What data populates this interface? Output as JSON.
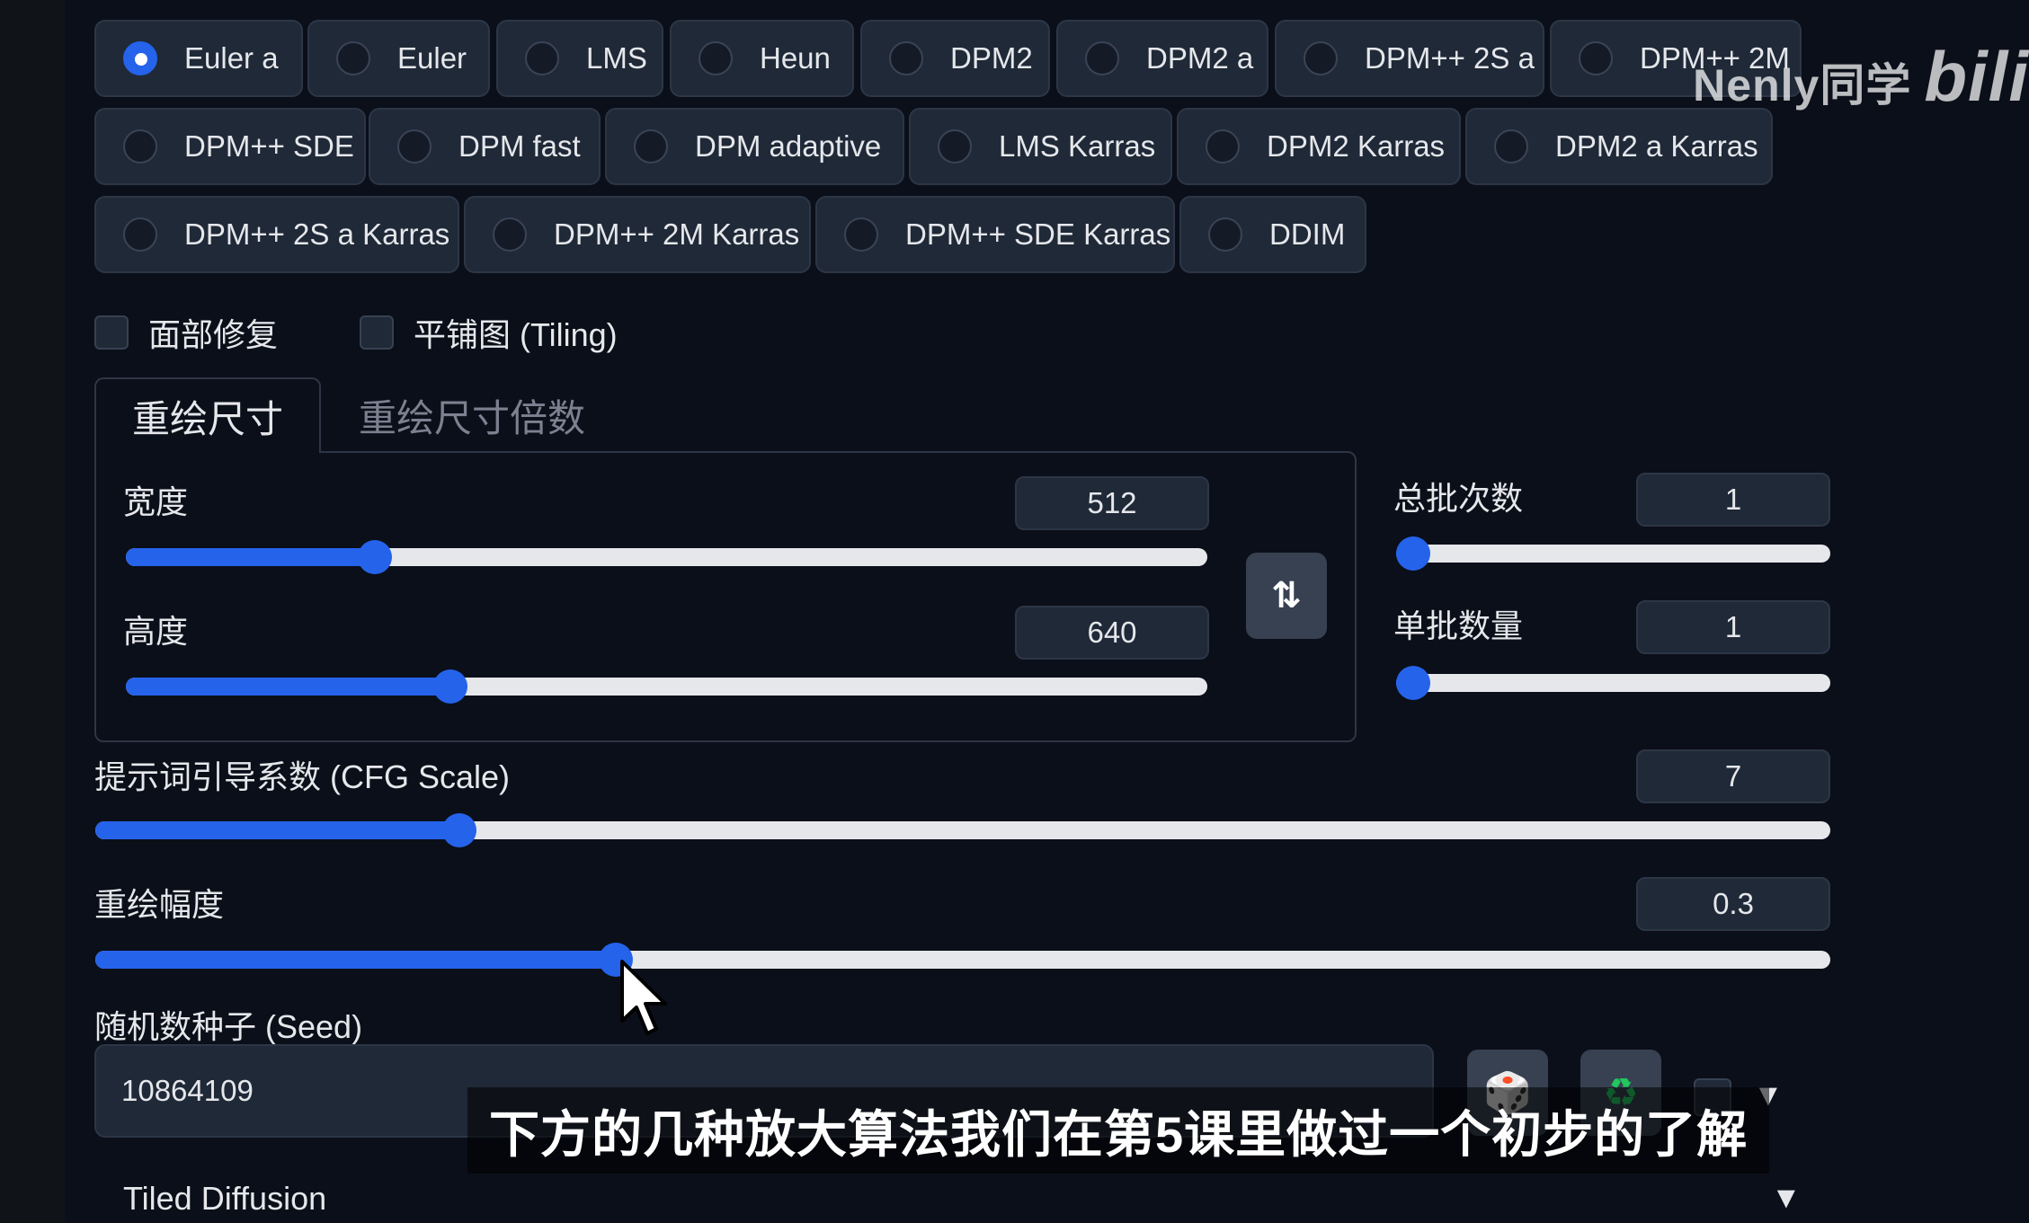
{
  "sampler": {
    "options": [
      "Euler a",
      "Euler",
      "LMS",
      "Heun",
      "DPM2",
      "DPM2 a",
      "DPM++ 2S a",
      "DPM++ 2M",
      "DPM++ SDE",
      "DPM fast",
      "DPM adaptive",
      "LMS Karras",
      "DPM2 Karras",
      "DPM2 a Karras",
      "DPM++ 2S a Karras",
      "DPM++ 2M Karras",
      "DPM++ SDE Karras",
      "DDIM"
    ],
    "selected": "Euler a"
  },
  "watermark": {
    "text": "Nenly同学",
    "logo": "bili"
  },
  "options": {
    "face_restore": "面部修复",
    "tiling": "平铺图 (Tiling)"
  },
  "tabs": {
    "active": "重绘尺寸",
    "inactive": "重绘尺寸倍数"
  },
  "width": {
    "label": "宽度",
    "value": "512",
    "fraction": 0.23
  },
  "height": {
    "label": "高度",
    "value": "640",
    "fraction": 0.3
  },
  "batch_count": {
    "label": "总批次数",
    "value": "1",
    "fraction": 0.0
  },
  "batch_size": {
    "label": "单批数量",
    "value": "1",
    "fraction": 0.0
  },
  "cfg_scale": {
    "label": "提示词引导系数 (CFG Scale)",
    "value": "7",
    "fraction": 0.21
  },
  "denoise": {
    "label": "重绘幅度",
    "value": "0.3",
    "fraction": 0.3
  },
  "seed": {
    "label": "随机数种子 (Seed)",
    "value": "10864109"
  },
  "swap_icon": "⇅",
  "dice_icon": "🎲",
  "recycle_icon": "♻",
  "extension": {
    "label": "Tiled Diffusion"
  },
  "caption": "下方的几种放大算法我们在第5课里做过一个初步的了解",
  "colors": {
    "accent": "#2563eb",
    "background": "#0b0f19",
    "control": "#1f2937"
  }
}
